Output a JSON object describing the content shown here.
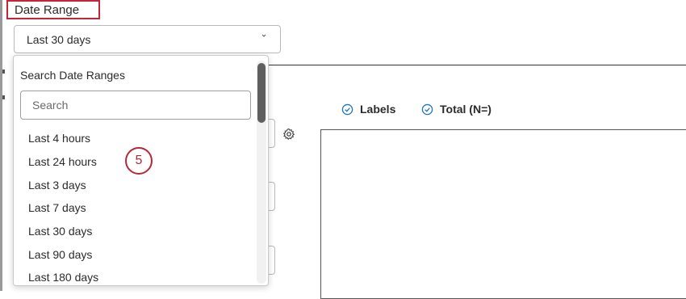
{
  "date_range": {
    "label": "Date Range",
    "selected_value": "Last 30 days"
  },
  "legend": [
    {
      "label": "Labels",
      "icon": "check-circle-icon"
    },
    {
      "label": "Total (N=)",
      "icon": "check-circle-icon"
    }
  ],
  "dropdown": {
    "header": "Search Date Ranges",
    "search_placeholder": "Search",
    "options": [
      {
        "label": "Last 4 hours"
      },
      {
        "label": "Last 24 hours"
      },
      {
        "label": "Last 3 days"
      },
      {
        "label": "Last 7 days"
      },
      {
        "label": "Last 30 days"
      },
      {
        "label": "Last 90 days"
      },
      {
        "label": "Last 180 days"
      }
    ]
  },
  "step_badge": "5",
  "colors": {
    "annotation_red": "#c3263a",
    "check_blue": "#1a73c8",
    "scroll_thumb": "#5f5f5f"
  }
}
